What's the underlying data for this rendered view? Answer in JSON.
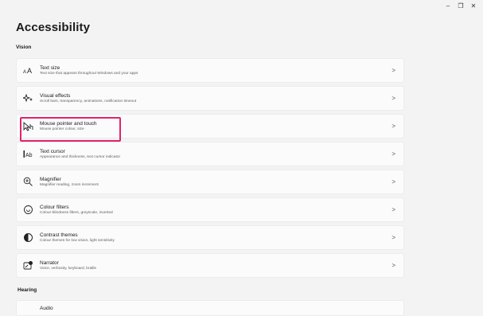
{
  "window": {
    "minimize": "–",
    "restore": "❐",
    "close": "✕"
  },
  "page": {
    "title": "Accessibility"
  },
  "sections": {
    "vision": "Vision",
    "hearing": "Hearing"
  },
  "items": [
    {
      "title": "Text size",
      "subtitle": "Text size that appears throughout Windows and your apps",
      "icon": "text-size-icon"
    },
    {
      "title": "Visual effects",
      "subtitle": "Scroll bars, transparency, animations, notification timeout",
      "icon": "visual-effects-icon"
    },
    {
      "title": "Mouse pointer and touch",
      "subtitle": "Mouse pointer colour, size",
      "icon": "mouse-pointer-icon"
    },
    {
      "title": "Text cursor",
      "subtitle": "Appearance and thickness, text cursor indicator",
      "icon": "text-cursor-icon"
    },
    {
      "title": "Magnifier",
      "subtitle": "Magnifier reading, zoom increment",
      "icon": "magnifier-icon"
    },
    {
      "title": "Colour filters",
      "subtitle": "Colour-blindness filters, greyscale, inverted",
      "icon": "colour-filters-icon"
    },
    {
      "title": "Contrast themes",
      "subtitle": "Colour themes for low vision, light sensitivity",
      "icon": "contrast-themes-icon"
    },
    {
      "title": "Narrator",
      "subtitle": "Voice, verbosity, keyboard, braille",
      "icon": "narrator-icon"
    }
  ],
  "chevron": ">",
  "hearing_first": {
    "title": "Audio"
  },
  "highlight_color": "#e0246b"
}
